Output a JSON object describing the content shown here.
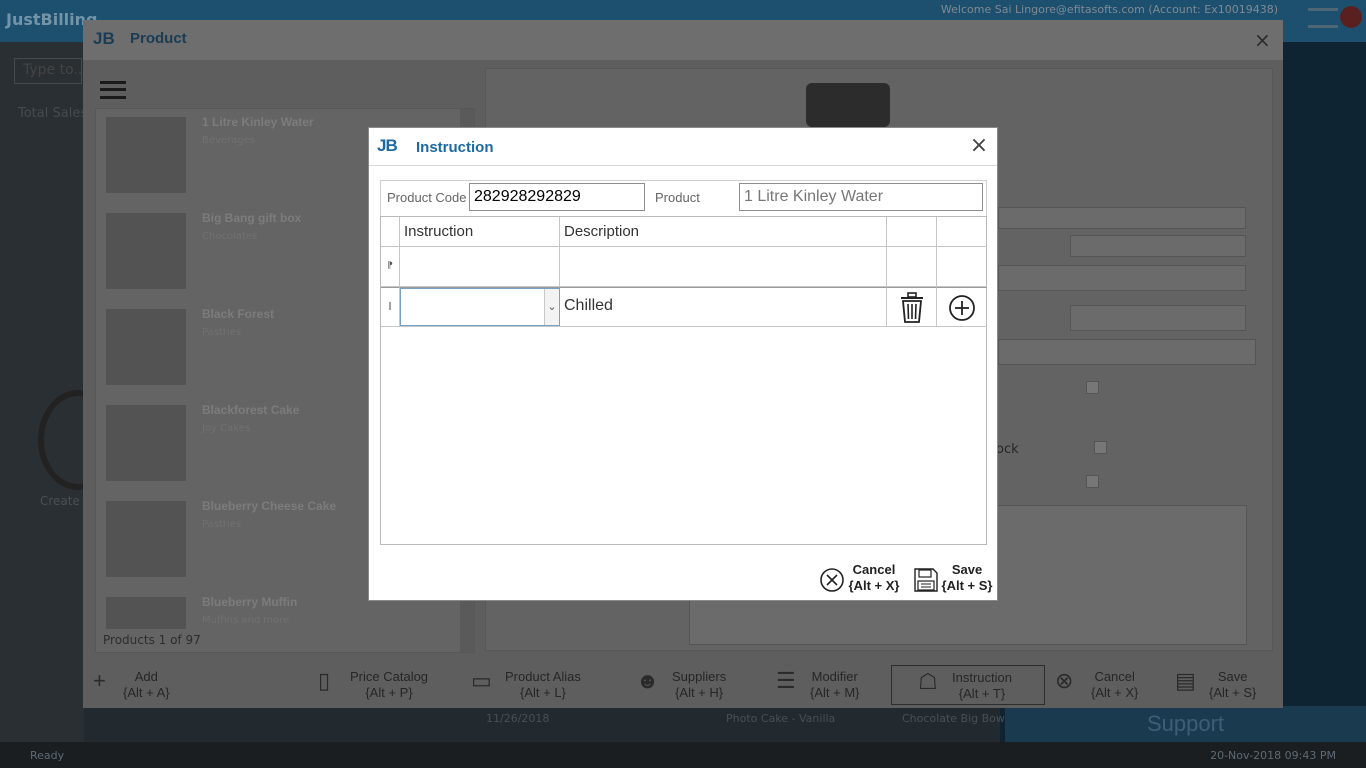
{
  "app": {
    "logo": "JustBilling",
    "welcome": "Welcome Sai Lingore@efitasofts.com (Account: Ex10019438)",
    "status_ready": "Ready",
    "status_datetime": "20-Nov-2018 09:43 PM",
    "support_label": "Support",
    "search_placeholder": "Type to...",
    "total_sales": "Total Sales",
    "create_label": "Create",
    "bg_date": "11/26/2018",
    "bg_item1": "Photo Cake - Vanilla",
    "bg_item2": "Chocolate Big Bow C..."
  },
  "product_dialog": {
    "logo": "JB",
    "title": "Product",
    "close_icon": "×",
    "items": [
      {
        "name": "1 Litre Kinley Water",
        "category": "Beverages"
      },
      {
        "name": "Big Bang gift box",
        "category": "Chocolates"
      },
      {
        "name": "Black Forest",
        "category": "Pastries"
      },
      {
        "name": "Blackforest Cake",
        "category": "Joy Cakes"
      },
      {
        "name": "Blueberry Cheese Cake",
        "category": "Pastries"
      },
      {
        "name": "Blueberry Muffin",
        "category": "Muffins and more"
      }
    ],
    "count": "Products 1 of 97",
    "stock_label": "ock",
    "toolbar": [
      {
        "icon": "+",
        "label": "Add",
        "shortcut": "{Alt + A}"
      },
      {
        "icon": "▯",
        "label": "Price Catalog",
        "shortcut": "{Alt + P}"
      },
      {
        "icon": "▭",
        "label": "Product Alias",
        "shortcut": "{Alt + L}"
      },
      {
        "icon": "☻",
        "label": "Suppliers",
        "shortcut": "{Alt + H}"
      },
      {
        "icon": "☰",
        "label": "Modifier",
        "shortcut": "{Alt + M}"
      },
      {
        "icon": "☖",
        "label": "Instruction",
        "shortcut": "{Alt + T}"
      },
      {
        "icon": "⊗",
        "label": "Cancel",
        "shortcut": "{Alt + X}"
      },
      {
        "icon": "▤",
        "label": "Save",
        "shortcut": "{Alt + S}"
      }
    ]
  },
  "instruction_dialog": {
    "logo": "JB",
    "title": "Instruction",
    "close_icon": "×",
    "product_code_label": "Product Code",
    "product_code_value": "282928292829",
    "product_label": "Product",
    "product_value": "1 Litre Kinley Water",
    "columns": [
      "Instruction",
      "Description"
    ],
    "new_row_marker": "⁋",
    "row_cursor": "I",
    "rows": [
      {
        "instruction": "",
        "description": "Chilled"
      }
    ],
    "cancel": {
      "label": "Cancel",
      "shortcut": "{Alt + X}"
    },
    "save": {
      "label": "Save",
      "shortcut": "{Alt + S}"
    }
  }
}
